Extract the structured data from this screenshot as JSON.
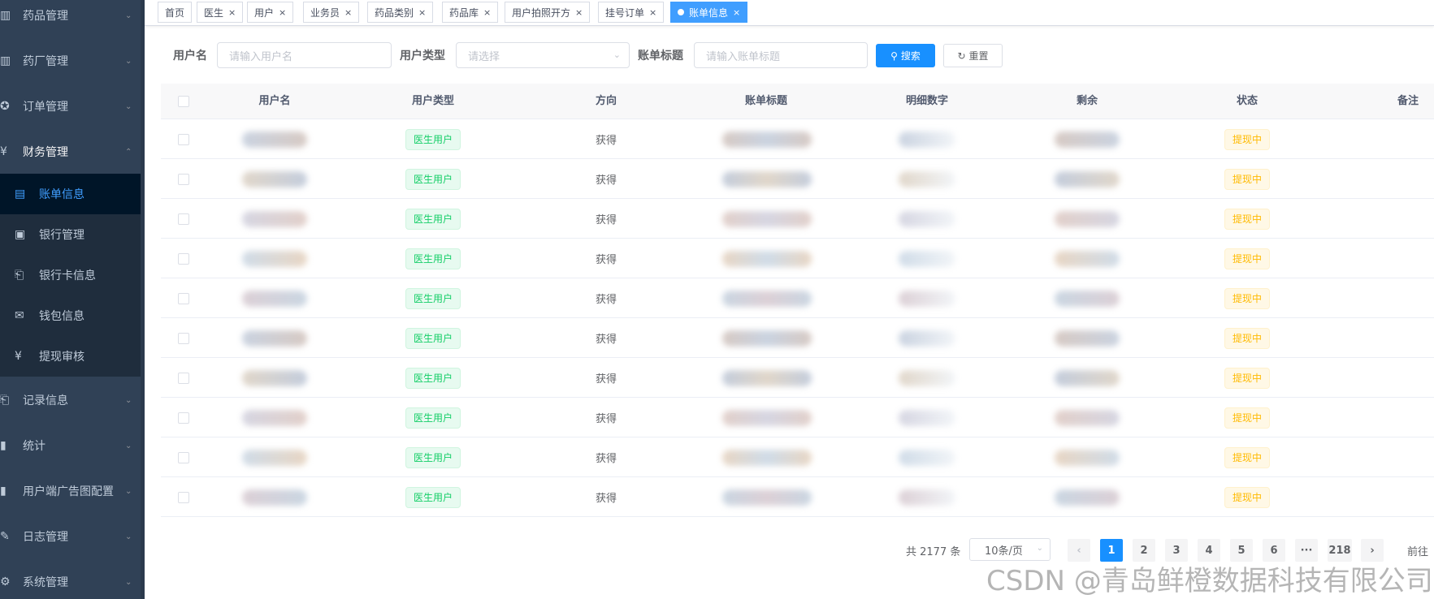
{
  "sidebar": {
    "menus": [
      {
        "icon": "pill-icon",
        "glyph": "▥",
        "label": "药品管理"
      },
      {
        "icon": "factory-icon",
        "glyph": "▥",
        "label": "药厂管理"
      },
      {
        "icon": "order-icon",
        "glyph": "✪",
        "label": "订单管理"
      },
      {
        "icon": "yen-icon",
        "glyph": "¥",
        "label": "财务管理"
      }
    ],
    "submenu": [
      {
        "icon": "bill-icon",
        "glyph": "▤",
        "label": "账单信息",
        "active": true
      },
      {
        "icon": "bank-icon",
        "glyph": "▣",
        "label": "银行管理"
      },
      {
        "icon": "card-icon",
        "glyph": "⎗",
        "label": "银行卡信息"
      },
      {
        "icon": "wallet-icon",
        "glyph": "✉",
        "label": "钱包信息"
      },
      {
        "icon": "withdraw-icon",
        "glyph": "¥",
        "label": "提现审核"
      }
    ],
    "lower_menus": [
      {
        "icon": "record-icon",
        "glyph": "⎗",
        "label": "记录信息"
      },
      {
        "icon": "chart-icon",
        "glyph": "▮",
        "label": "统计"
      },
      {
        "icon": "ad-icon",
        "glyph": "▮",
        "label": "用户端广告图配置"
      },
      {
        "icon": "log-icon",
        "glyph": "✎",
        "label": "日志管理"
      },
      {
        "icon": "settings-icon",
        "glyph": "⚙",
        "label": "系统管理"
      }
    ]
  },
  "tags": [
    {
      "label": "首页",
      "closable": false
    },
    {
      "label": "医生",
      "closable": true
    },
    {
      "label": "用户",
      "closable": true
    },
    {
      "label": "业务员",
      "closable": true
    },
    {
      "label": "药品类别",
      "closable": true
    },
    {
      "label": "药品库",
      "closable": true
    },
    {
      "label": "用户拍照开方",
      "closable": true
    },
    {
      "label": "挂号订单",
      "closable": true
    },
    {
      "label": "账单信息",
      "closable": true,
      "active": true
    }
  ],
  "search": {
    "username_label": "用户名",
    "username_placeholder": "请输入用户名",
    "usertype_label": "用户类型",
    "usertype_placeholder": "请选择",
    "title_label": "账单标题",
    "title_placeholder": "请输入账单标题",
    "search_button": "搜索",
    "reset_button": "重置"
  },
  "table": {
    "columns": [
      "用户名",
      "用户类型",
      "方向",
      "账单标题",
      "明细数字",
      "剩余",
      "状态",
      "备注"
    ],
    "rows": [
      {
        "usertype": "医生用户",
        "direction": "获得",
        "status": "提现中"
      },
      {
        "usertype": "医生用户",
        "direction": "获得",
        "status": "提现中"
      },
      {
        "usertype": "医生用户",
        "direction": "获得",
        "status": "提现中"
      },
      {
        "usertype": "医生用户",
        "direction": "获得",
        "status": "提现中"
      },
      {
        "usertype": "医生用户",
        "direction": "获得",
        "status": "提现中"
      },
      {
        "usertype": "医生用户",
        "direction": "获得",
        "status": "提现中"
      },
      {
        "usertype": "医生用户",
        "direction": "获得",
        "status": "提现中"
      },
      {
        "usertype": "医生用户",
        "direction": "获得",
        "status": "提现中"
      },
      {
        "usertype": "医生用户",
        "direction": "获得",
        "status": "提现中"
      },
      {
        "usertype": "医生用户",
        "direction": "获得",
        "status": "提现中"
      }
    ]
  },
  "pagination": {
    "total": "共 2177 条",
    "page_size": "10条/页",
    "pages": [
      "1",
      "2",
      "3",
      "4",
      "5",
      "6",
      "···",
      "218"
    ],
    "current": "1",
    "goto": "前往"
  },
  "watermark": "CSDN @青岛鲜橙数据科技有限公司"
}
